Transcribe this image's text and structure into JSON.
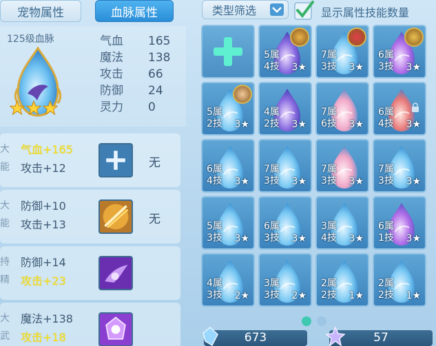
{
  "tabs": {
    "pet_attributes": "宠物属性",
    "bloodline_attributes": "血脉属性"
  },
  "pet_info": {
    "level_text": "125级血脉",
    "star_count": 3,
    "stats": [
      {
        "name": "气血",
        "value": "165"
      },
      {
        "name": "魔法",
        "value": "138"
      },
      {
        "name": "攻击",
        "value": "66"
      },
      {
        "name": "防御",
        "value": "24"
      },
      {
        "name": "灵力",
        "value": "0"
      }
    ]
  },
  "attribute_rows": [
    {
      "side": [
        "大",
        "能"
      ],
      "line1": "气血+165",
      "line1_color": "yellow",
      "line2": "攻击+12",
      "line2_color": "dark",
      "skill": "add",
      "skill_label": "无"
    },
    {
      "side": [
        "大",
        "能"
      ],
      "line1": "防御+10",
      "line1_color": "dark",
      "line2": "攻击+13",
      "line2_color": "dark",
      "skill": "gold-slash-icon",
      "skill_label": "无"
    },
    {
      "side": [
        "持",
        "精"
      ],
      "line1": "防御+14",
      "line1_color": "dark",
      "line2": "攻击+23",
      "line2_color": "yellow",
      "skill": "purple-wing-icon",
      "skill_label": ""
    },
    {
      "side": [
        "大",
        "武"
      ],
      "line1": "魔法+138",
      "line1_color": "dark",
      "line2": "攻击+18",
      "line2_color": "yellow",
      "skill": "purple-crystal-icon",
      "skill_label": ""
    }
  ],
  "filter": {
    "label": "类型筛选",
    "show_label": "显示属性技能数量",
    "checked": true
  },
  "grid": [
    {
      "type": "add"
    },
    {
      "attr": "5属",
      "skill": "4技",
      "star": "3★",
      "egg": "purple",
      "badge": "gold-warrior"
    },
    {
      "attr": "7属",
      "skill": "3技",
      "star": "3★",
      "egg": "blue",
      "badge": "red-hair-girl"
    },
    {
      "attr": "6属",
      "skill": "3技",
      "star": "3★",
      "egg": "purple-swirl",
      "badge": "gold-helmet"
    },
    {
      "attr": "5属",
      "skill": "2技",
      "star": "3★",
      "egg": "blue",
      "badge": "monk"
    },
    {
      "attr": "4属",
      "skill": "2技",
      "star": "3★",
      "egg": "purple",
      "badge": ""
    },
    {
      "attr": "7属",
      "skill": "6技",
      "star": "3★",
      "egg": "pink",
      "badge": ""
    },
    {
      "attr": "6属",
      "skill": "4技",
      "star": "3★",
      "egg": "red-mask",
      "badge": "",
      "lock": true
    },
    {
      "attr": "6属",
      "skill": "4技",
      "star": "3★",
      "egg": "blue",
      "badge": ""
    },
    {
      "attr": "7属",
      "skill": "3技",
      "star": "3★",
      "egg": "blue",
      "badge": ""
    },
    {
      "attr": "7属",
      "skill": "3技",
      "star": "3★",
      "egg": "pink",
      "badge": ""
    },
    {
      "attr": "7属",
      "skill": "3技",
      "star": "3★",
      "egg": "blue",
      "badge": ""
    },
    {
      "attr": "5属",
      "skill": "3技",
      "star": "3★",
      "egg": "blue",
      "badge": ""
    },
    {
      "attr": "6属",
      "skill": "3技",
      "star": "3★",
      "egg": "blue",
      "badge": ""
    },
    {
      "attr": "3属",
      "skill": "4技",
      "star": "3★",
      "egg": "blue",
      "badge": ""
    },
    {
      "attr": "6属",
      "skill": "1技",
      "star": "3★",
      "egg": "purple-swirl",
      "badge": ""
    },
    {
      "attr": "4属",
      "skill": "3技",
      "star": "2★",
      "egg": "blue",
      "badge": ""
    },
    {
      "attr": "3属",
      "skill": "3技",
      "star": "2★",
      "egg": "blue",
      "badge": ""
    },
    {
      "attr": "2属",
      "skill": "2技",
      "star": "1★",
      "egg": "blue",
      "badge": ""
    },
    {
      "attr": "2属",
      "skill": "2技",
      "star": "1★",
      "egg": "blue",
      "badge": ""
    }
  ],
  "pagination": {
    "pages": 2,
    "active": 1
  },
  "resources": [
    {
      "icon": "blue-crystal-icon",
      "value": "673"
    },
    {
      "icon": "star-crystal-icon",
      "value": "57"
    }
  ],
  "colors": {
    "active_tab": "#2a8ed8",
    "stat_yellow": "#f5e02a",
    "cell_blue": "#4a92c8"
  }
}
